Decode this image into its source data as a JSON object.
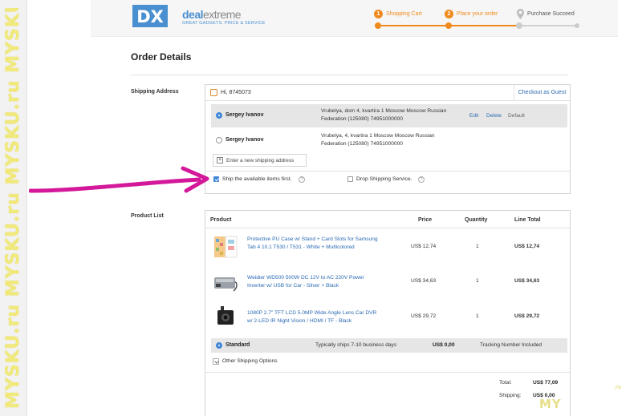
{
  "watermark": {
    "text": "MYSKU.ru MYSKU.ru MYSKU.ru MYSKU.ru MYSKU.ru",
    "corner": "MY",
    "corner_suffix": ".ru"
  },
  "brand": {
    "logo_letters": "DX",
    "name_deal": "deal",
    "name_extreme": "extreme",
    "tagline": "GREAT GADGETS. PRICE & SERVICE"
  },
  "steps": [
    {
      "num": "1",
      "label": "Shopping Cart"
    },
    {
      "num": "2",
      "label": "Place your order"
    },
    {
      "num": "",
      "label": "Purchase Succeed"
    }
  ],
  "page_title": "Order Details",
  "shipping": {
    "label": "Shipping Address",
    "greeting": "Hi, 8745073",
    "guest_link": "Checkout as Guest",
    "addresses": [
      {
        "name": "Sergey Ivanov",
        "line1": "Vrubelya, dom 4, kvartira 1 Moscow Moscow Russian",
        "line2": "Federation (125080) 74951000000",
        "edit": "Edit",
        "delete": "Delete",
        "default": "Default"
      },
      {
        "name": "Sergey Ivanov",
        "line1": "Vrubelya, 4, kvartira 1 Moscow Moscow Russian",
        "line2": "Federation (125080) 74951000000"
      }
    ],
    "new_address": "Enter a new shipping address",
    "ship_available": "Ship the available items first.",
    "drop_shipping": "Drop Shipping Service."
  },
  "products": {
    "label": "Product List",
    "headers": {
      "product": "Product",
      "price": "Price",
      "quantity": "Quantity",
      "line_total": "Line Total"
    },
    "items": [
      {
        "name": "Protective PU Case w/ Stand + Card Slots for Samsung Tab 4 10.1 T530 / T531 - White + Multicolored",
        "price": "US$ 12,74",
        "qty": "1",
        "total": "US$ 12,74"
      },
      {
        "name": "Weidier WD500 500W DC 12V to AC 220V Power Inverter w/ USB for Car - Silver + Black",
        "price": "US$ 34,63",
        "qty": "1",
        "total": "US$ 34,63"
      },
      {
        "name": "1080P 2.7\" TFT LCD 5.0MP Wide Angle Lens Car DVR w/ 2-LED IR Night Vision / HDMI / TF - Black",
        "price": "US$ 29,72",
        "qty": "1",
        "total": "US$ 29,72"
      }
    ],
    "shipping_method": {
      "name": "Standard",
      "ships": "Typically ships 7-10 business days",
      "price": "US$ 0,00",
      "tracking": "Tracking Number Included"
    },
    "other_options": "Other Shipping Options",
    "summary": {
      "total_label": "Total:",
      "total_value": "US$ 77,09",
      "shipping_label": "Shipping:",
      "shipping_value": "US$ 0,00"
    }
  },
  "colors": {
    "accent_orange": "#f08a1c",
    "link_blue": "#2a6ab3",
    "annotation_magenta": "#d4189a"
  }
}
